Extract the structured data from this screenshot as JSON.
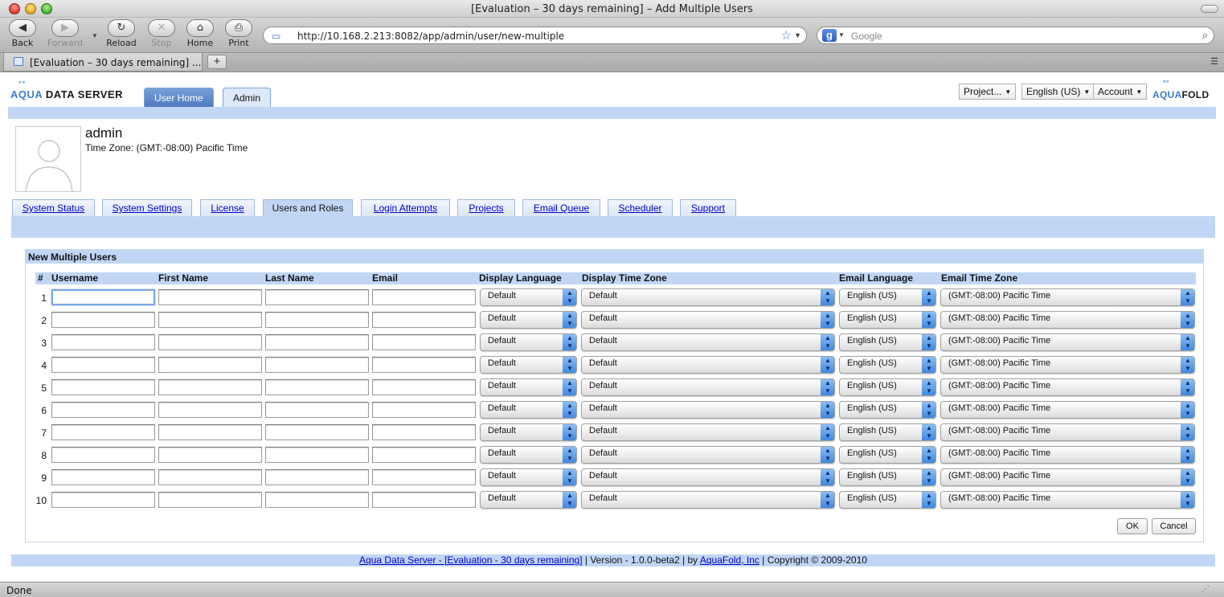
{
  "window": {
    "title": "[Evaluation – 30 days remaining] – Add Multiple Users"
  },
  "nav": {
    "back": "Back",
    "forward": "Forward",
    "reload": "Reload",
    "stop": "Stop",
    "home": "Home",
    "print": "Print"
  },
  "urlbar": {
    "url": "http://10.168.2.213:8082/app/admin/user/new-multiple"
  },
  "search": {
    "placeholder": "Google"
  },
  "browser_tab": {
    "title": "[Evaluation – 30 days remaining] ..."
  },
  "status": {
    "text": "Done"
  },
  "app": {
    "logo_aqua": "AQUA",
    "logo_data_server": "DATA SERVER",
    "logo2_aqua": "AQUA",
    "logo2_fold": "FOLD",
    "tabs": {
      "user_home": "User Home",
      "admin": "Admin"
    },
    "menus": {
      "project": "Project...",
      "language": "English (US)",
      "account": "Account"
    }
  },
  "user": {
    "name": "admin",
    "timezone": "Time Zone: (GMT:-08:00) Pacific Time"
  },
  "admin_tabs": [
    "System Status",
    "System Settings",
    "License",
    "Users and Roles",
    "Login Attempts",
    "Projects",
    "Email Queue",
    "Scheduler",
    "Support"
  ],
  "active_admin_tab": "Users and Roles",
  "form": {
    "title": "New Multiple Users",
    "columns": [
      "#",
      "Username",
      "First Name",
      "Last Name",
      "Email",
      "Display Language",
      "Display Time Zone",
      "Email Language",
      "Email Time Zone"
    ],
    "rows": [
      {
        "num": "1",
        "username": "",
        "first_name": "",
        "last_name": "",
        "email": "",
        "display_language": "Default",
        "display_time_zone": "Default",
        "email_language": "English (US)",
        "email_time_zone": "(GMT:-08:00) Pacific Time"
      },
      {
        "num": "2",
        "username": "",
        "first_name": "",
        "last_name": "",
        "email": "",
        "display_language": "Default",
        "display_time_zone": "Default",
        "email_language": "English (US)",
        "email_time_zone": "(GMT:-08:00) Pacific Time"
      },
      {
        "num": "3",
        "username": "",
        "first_name": "",
        "last_name": "",
        "email": "",
        "display_language": "Default",
        "display_time_zone": "Default",
        "email_language": "English (US)",
        "email_time_zone": "(GMT:-08:00) Pacific Time"
      },
      {
        "num": "4",
        "username": "",
        "first_name": "",
        "last_name": "",
        "email": "",
        "display_language": "Default",
        "display_time_zone": "Default",
        "email_language": "English (US)",
        "email_time_zone": "(GMT:-08:00) Pacific Time"
      },
      {
        "num": "5",
        "username": "",
        "first_name": "",
        "last_name": "",
        "email": "",
        "display_language": "Default",
        "display_time_zone": "Default",
        "email_language": "English (US)",
        "email_time_zone": "(GMT:-08:00) Pacific Time"
      },
      {
        "num": "6",
        "username": "",
        "first_name": "",
        "last_name": "",
        "email": "",
        "display_language": "Default",
        "display_time_zone": "Default",
        "email_language": "English (US)",
        "email_time_zone": "(GMT:-08:00) Pacific Time"
      },
      {
        "num": "7",
        "username": "",
        "first_name": "",
        "last_name": "",
        "email": "",
        "display_language": "Default",
        "display_time_zone": "Default",
        "email_language": "English (US)",
        "email_time_zone": "(GMT:-08:00) Pacific Time"
      },
      {
        "num": "8",
        "username": "",
        "first_name": "",
        "last_name": "",
        "email": "",
        "display_language": "Default",
        "display_time_zone": "Default",
        "email_language": "English (US)",
        "email_time_zone": "(GMT:-08:00) Pacific Time"
      },
      {
        "num": "9",
        "username": "",
        "first_name": "",
        "last_name": "",
        "email": "",
        "display_language": "Default",
        "display_time_zone": "Default",
        "email_language": "English (US)",
        "email_time_zone": "(GMT:-08:00) Pacific Time"
      },
      {
        "num": "10",
        "username": "",
        "first_name": "",
        "last_name": "",
        "email": "",
        "display_language": "Default",
        "display_time_zone": "Default",
        "email_language": "English (US)",
        "email_time_zone": "(GMT:-08:00) Pacific Time"
      }
    ],
    "ok_label": "OK",
    "cancel_label": "Cancel"
  },
  "footer": {
    "product_link": "Aqua Data Server - [Evaluation - 30 days remaining]",
    "version": " | Version - 1.0.0-beta2 | by ",
    "company_link": "AquaFold, Inc",
    "copyright": " | Copyright © 2009-2010"
  },
  "icons": {
    "back": "back-arrow-icon",
    "forward": "forward-arrow-icon",
    "reload": "reload-icon",
    "stop": "stop-icon",
    "home": "home-icon",
    "print": "printer-icon",
    "bookmark": "star-icon",
    "search": "magnifier-icon"
  },
  "colors": {
    "header_band": "#c1d6f5",
    "link": "#0000c8",
    "active_tab": "#4e7ac0",
    "select_arrow": "#3c86e0"
  }
}
